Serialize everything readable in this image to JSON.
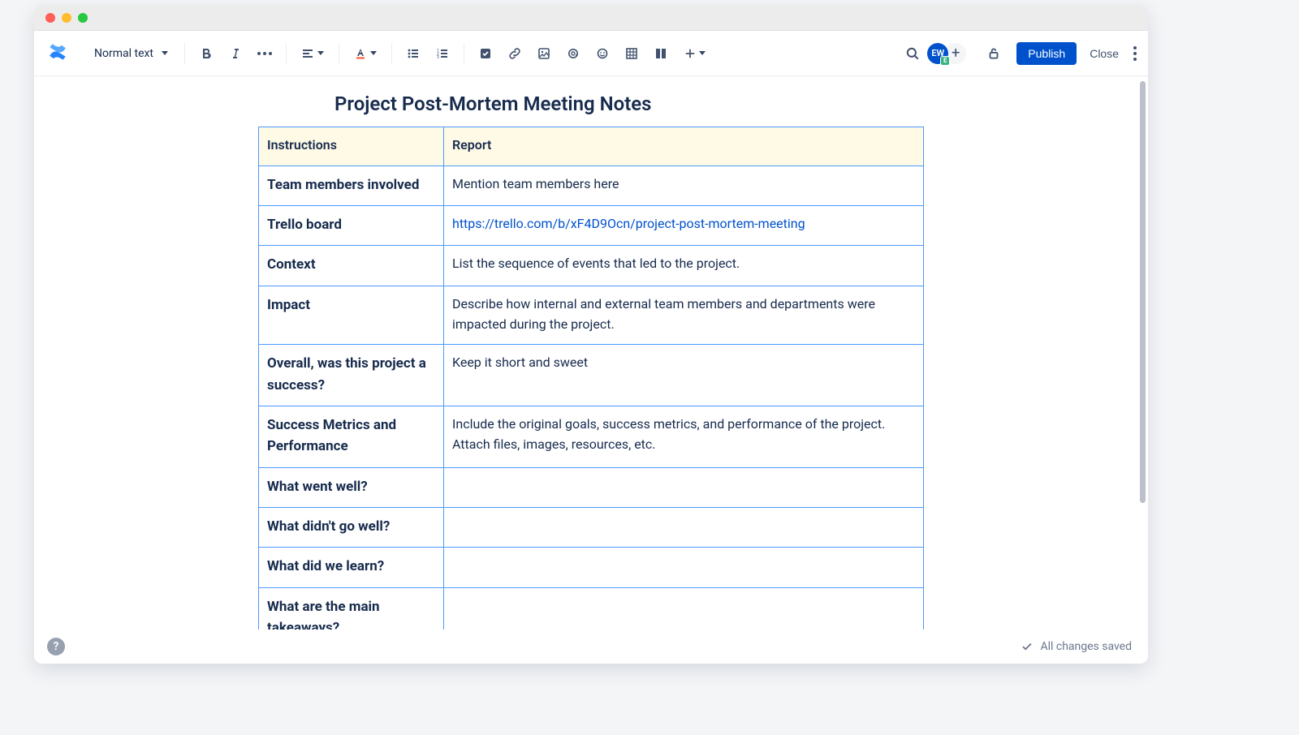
{
  "toolbar": {
    "text_style_label": "Normal text",
    "publish_label": "Publish",
    "close_label": "Close",
    "avatar_initials": "EW",
    "avatar_badge": "E",
    "invite_symbol": "+"
  },
  "document": {
    "title": "Project Post-Mortem Meeting Notes",
    "table": {
      "headers": [
        "Instructions",
        "Report"
      ],
      "rows": [
        {
          "label": "Team members involved",
          "content": "Mention team members here",
          "link": false
        },
        {
          "label": "Trello board",
          "content": "https://trello.com/b/xF4D9Ocn/project-post-mortem-meeting",
          "link": true
        },
        {
          "label": "Context",
          "content": "List the sequence of events that led to the project.",
          "link": false
        },
        {
          "label": "Impact",
          "content": "Describe how internal and external team members and departments were impacted during the project.",
          "link": false
        },
        {
          "label": "Overall, was this project a success?",
          "content": "Keep it short and sweet",
          "link": false
        },
        {
          "label": "Success Metrics and Performance",
          "content": "Include the original goals, success metrics, and performance of the project. Attach files, images, resources, etc.",
          "link": false
        },
        {
          "label": "What went well?",
          "content": "",
          "link": false
        },
        {
          "label": "What didn't go well?",
          "content": "",
          "link": false
        },
        {
          "label": "What did we learn?",
          "content": "",
          "link": false
        },
        {
          "label": "What are the main takeaways?",
          "content": "",
          "link": false
        },
        {
          "label": "",
          "content": "",
          "link": false
        }
      ]
    }
  },
  "footer": {
    "status_text": "All changes saved",
    "help_symbol": "?"
  }
}
